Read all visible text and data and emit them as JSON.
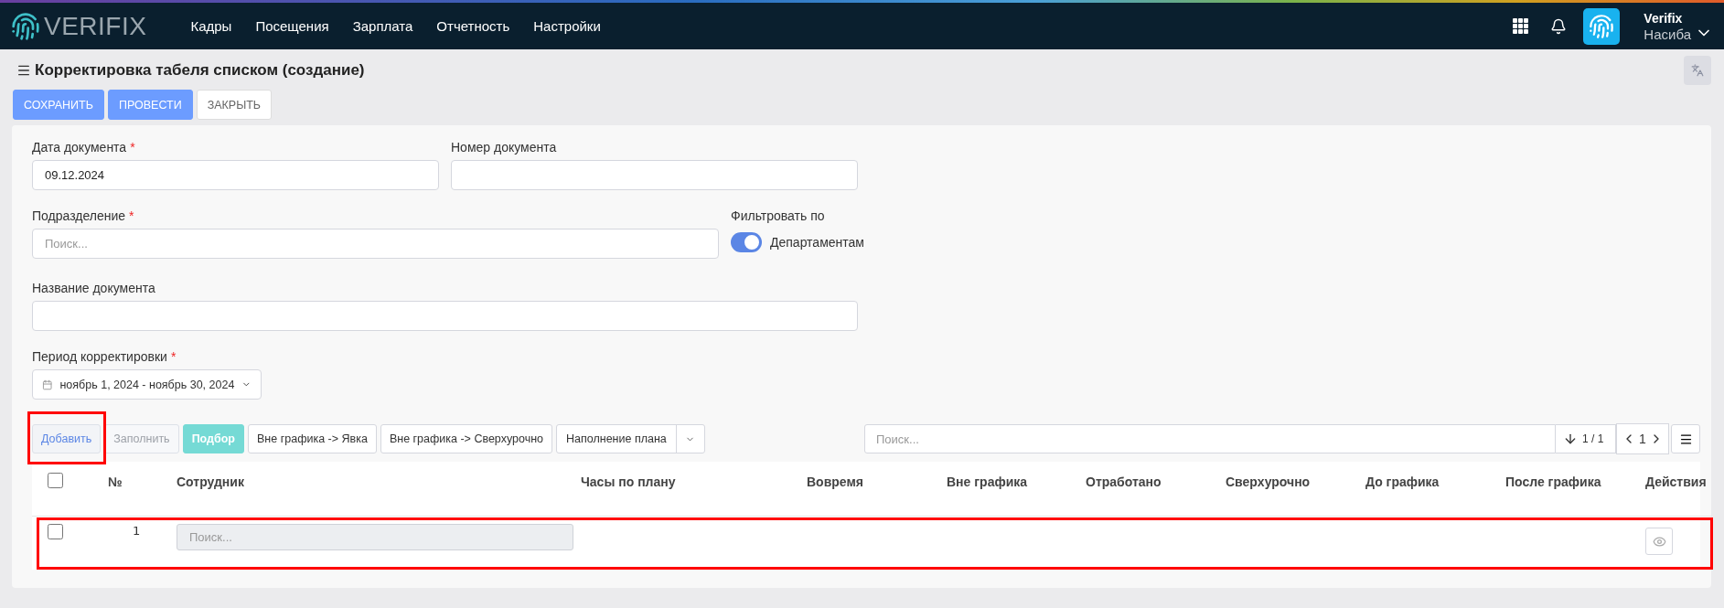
{
  "nav": {
    "logo": "VERIFIX",
    "menu": [
      "Кадры",
      "Посещения",
      "Зарплата",
      "Отчетность",
      "Настройки"
    ],
    "user": {
      "name": "Verifix",
      "subtitle": "Насиба"
    }
  },
  "page": {
    "title": "Корректировка табеля списком (создание)"
  },
  "actions": [
    {
      "label": "СОХРАНИТЬ",
      "kind": "primary"
    },
    {
      "label": "ПРОВЕСТИ",
      "kind": "primary"
    },
    {
      "label": "ЗАКРЫТЬ",
      "kind": "default"
    }
  ],
  "form": {
    "document_date": {
      "label": "Дата документа",
      "required_mark": "*",
      "value": "09.12.2024"
    },
    "document_number": {
      "label": "Номер документа"
    },
    "department": {
      "label": "Подразделение",
      "required_mark": "*",
      "placeholder": "Поиск..."
    },
    "filter": {
      "label": "Фильтровать по",
      "toggle_label": "Департаментам",
      "on": true
    },
    "document_name": {
      "label": "Название документа"
    },
    "period": {
      "label": "Период корректировки",
      "required_mark": "*",
      "value": "ноябрь 1, 2024 - ноябрь 30, 2024"
    }
  },
  "toolbar": {
    "buttons": [
      {
        "label": "Добавить",
        "kind": "light",
        "disabled": false,
        "highlighted": true
      },
      {
        "label": "Заполнить",
        "kind": "light",
        "disabled": true,
        "highlighted": false
      },
      {
        "label": "Подбор",
        "kind": "teal",
        "disabled": false,
        "highlighted": false
      },
      {
        "label": "Вне графика -> Явка",
        "kind": "outline",
        "disabled": false,
        "highlighted": false
      },
      {
        "label": "Вне графика -> Сверхурочно",
        "kind": "outline",
        "disabled": false,
        "highlighted": false
      },
      {
        "label": "Наполнение плана",
        "kind": "split",
        "disabled": false,
        "highlighted": false
      }
    ],
    "search": {
      "placeholder": "Поиск..."
    },
    "sort": "1 / 1",
    "page": "1"
  },
  "table": {
    "header_checked": false,
    "columns": [
      "№",
      "Сотрудник",
      "Часы по плану",
      "Вовремя",
      "Вне графика",
      "Отработано",
      "Сверхурочно",
      "До графика",
      "После графика",
      "Действия"
    ],
    "rows": [
      {
        "checked": false,
        "number": "1",
        "employee_placeholder": "Поиск...",
        "highlighted": true
      }
    ]
  }
}
